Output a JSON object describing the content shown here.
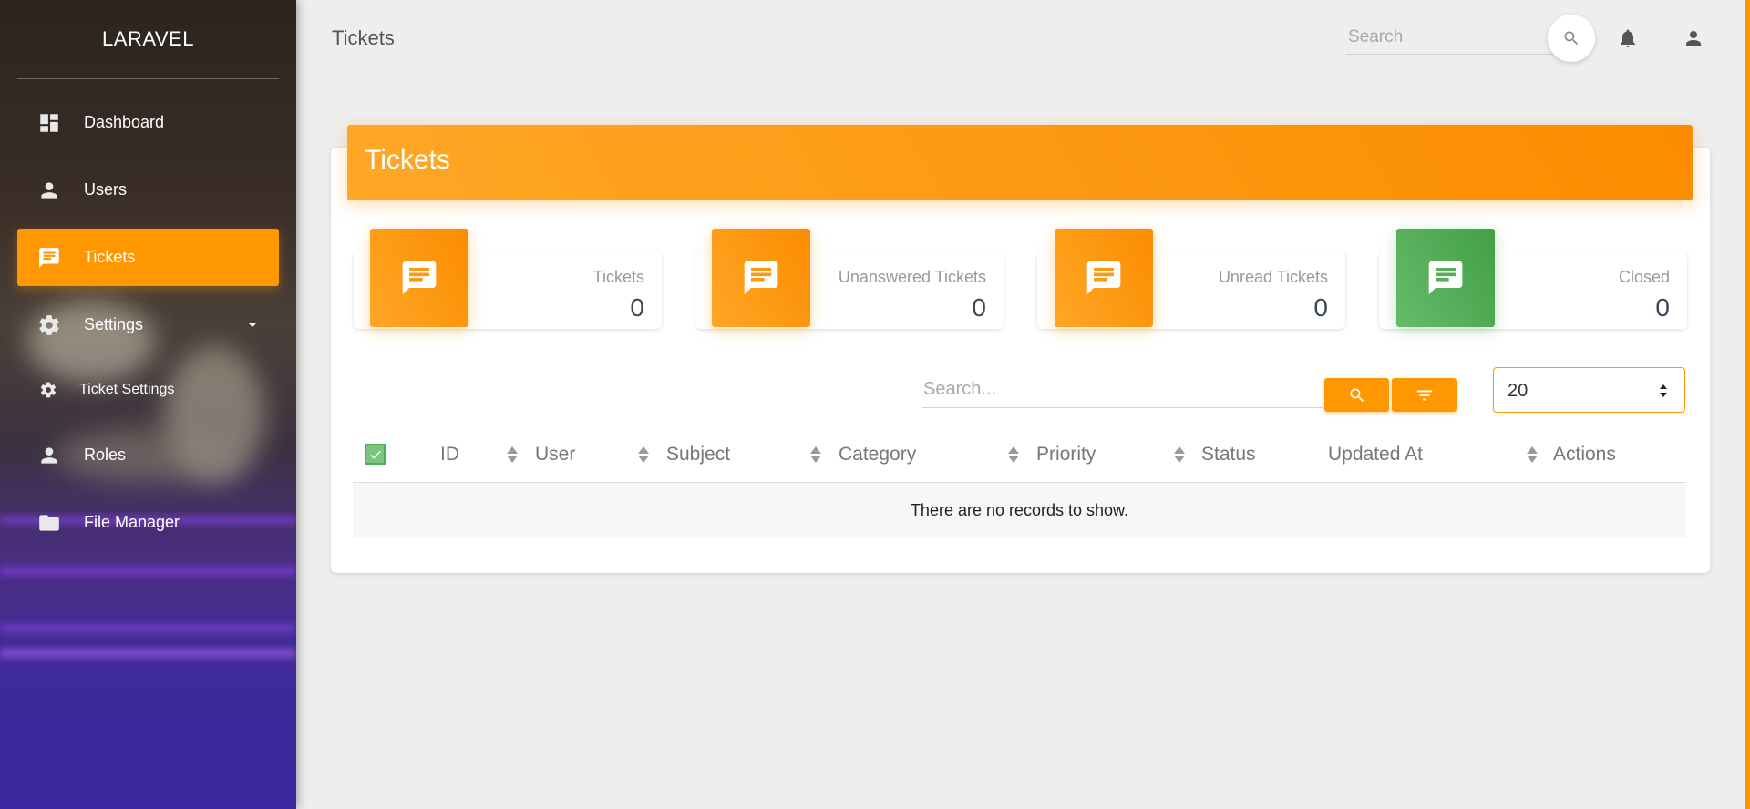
{
  "brand": "LARAVEL",
  "sidebar": {
    "items": [
      {
        "label": "Dashboard",
        "icon": "dashboard-icon"
      },
      {
        "label": "Users",
        "icon": "person-icon"
      },
      {
        "label": "Tickets",
        "icon": "chat-icon",
        "active": true
      },
      {
        "label": "Settings",
        "icon": "gear-icon",
        "expandable": true
      },
      {
        "label": "Ticket Settings",
        "icon": "gear-icon"
      },
      {
        "label": "Roles",
        "icon": "person-icon"
      },
      {
        "label": "File Manager",
        "icon": "folder-icon"
      }
    ]
  },
  "header": {
    "title": "Tickets",
    "search_placeholder": "Search"
  },
  "card": {
    "title": "Tickets"
  },
  "stats": [
    {
      "label": "Tickets",
      "value": "0",
      "color": "orange"
    },
    {
      "label": "Unanswered Tickets",
      "value": "0",
      "color": "orange"
    },
    {
      "label": "Unread Tickets",
      "value": "0",
      "color": "orange"
    },
    {
      "label": "Closed",
      "value": "0",
      "color": "green"
    }
  ],
  "table": {
    "search_placeholder": "Search...",
    "per_page": "20",
    "columns": [
      "ID",
      "User",
      "Subject",
      "Category",
      "Priority",
      "Status",
      "Updated At",
      "Actions"
    ],
    "empty_message": "There are no records to show."
  },
  "colors": {
    "accent": "#ff9800",
    "success": "#4caf50"
  }
}
